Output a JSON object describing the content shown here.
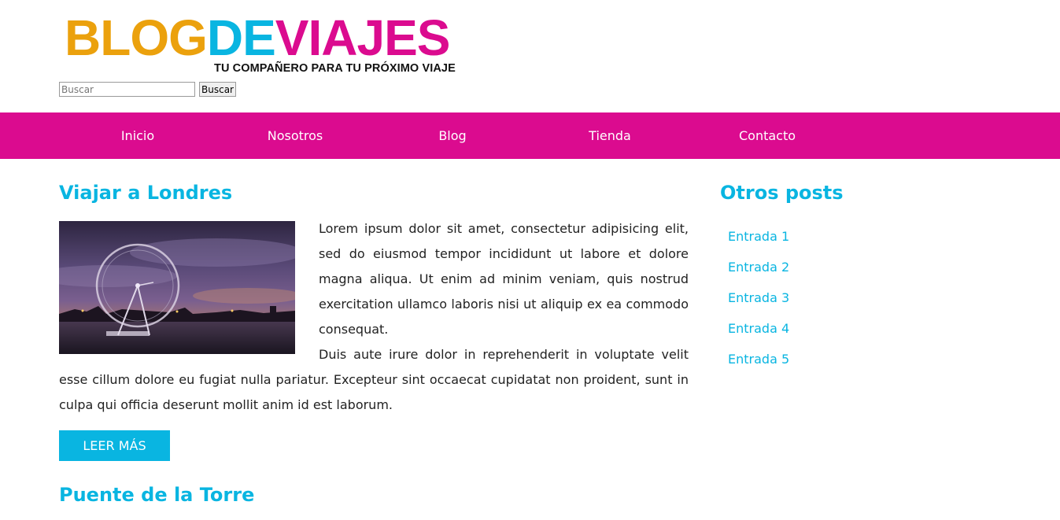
{
  "brand": {
    "logo_part1": "BLOG",
    "logo_part2": "DE",
    "logo_part3": "VIAJES",
    "tagline": "TU COMPAÑERO PARA TU PRÓXIMO VIAJE",
    "colors": {
      "orange": "#eba10d",
      "cyan": "#09b5e1",
      "magenta": "#db0b8f"
    }
  },
  "search": {
    "placeholder": "Buscar",
    "value": "",
    "button_label": "Buscar"
  },
  "nav": {
    "background": "#db0b8f",
    "items": [
      {
        "label": "Inicio"
      },
      {
        "label": "Nosotros"
      },
      {
        "label": "Blog"
      },
      {
        "label": "Tienda"
      },
      {
        "label": "Contacto"
      }
    ]
  },
  "posts": [
    {
      "title": "Viajar a Londres",
      "paragraph1": "Lorem ipsum dolor sit amet, consectetur adipisicing elit, sed do eiusmod tempor incididunt ut labore et dolore magna aliqua. Ut enim ad minim veniam, quis nostrud exercitation ullamco laboris nisi ut aliquip ex ea commodo consequat.",
      "paragraph2": "Duis aute irure dolor in reprehenderit in voluptate velit esse cillum dolore eu fugiat nulla pariatur. Excepteur sint occaecat cupidatat non proident, sunt in culpa qui officia deserunt mollit anim id est laborum.",
      "button_label": "LEER MÁS"
    },
    {
      "title": "Puente de la Torre"
    }
  ],
  "sidebar": {
    "title": "Otros posts",
    "items": [
      {
        "label": "Entrada 1"
      },
      {
        "label": "Entrada 2"
      },
      {
        "label": "Entrada 3"
      },
      {
        "label": "Entrada 4"
      },
      {
        "label": "Entrada 5"
      }
    ]
  }
}
